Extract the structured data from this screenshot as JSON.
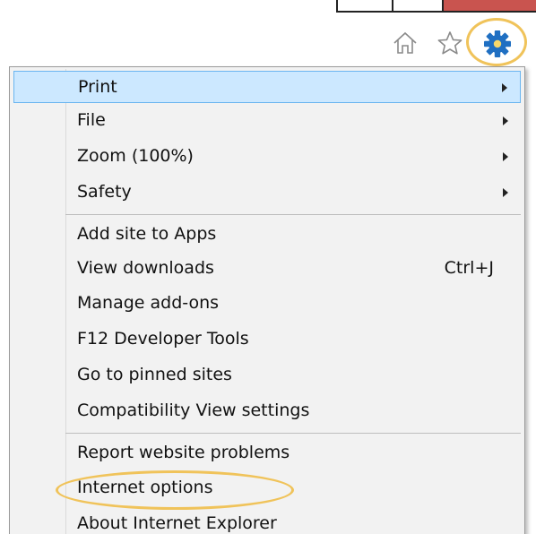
{
  "toolbar": {
    "icons": [
      "home-icon",
      "favorites-star-icon",
      "gear-icon"
    ]
  },
  "menu": {
    "groups": [
      [
        {
          "label": "Print",
          "has_submenu": true,
          "selected": true
        },
        {
          "label": "File",
          "has_submenu": true
        },
        {
          "label": "Zoom (100%)",
          "has_submenu": true
        },
        {
          "label": "Safety",
          "has_submenu": true
        }
      ],
      [
        {
          "label": "Add site to Apps"
        },
        {
          "label": "View downloads",
          "shortcut": "Ctrl+J"
        },
        {
          "label": "Manage add-ons"
        },
        {
          "label": "F12 Developer Tools"
        },
        {
          "label": "Go to pinned sites"
        },
        {
          "label": "Compatibility View settings"
        }
      ],
      [
        {
          "label": "Report website problems"
        },
        {
          "label": "Internet options",
          "highlighted": true
        },
        {
          "label": "About Internet Explorer"
        }
      ]
    ]
  },
  "colors": {
    "selection_fill": "#cce8ff",
    "selection_border": "#6ab5f0",
    "highlight_circle": "#f0c35a",
    "close_button": "#c9544f",
    "menu_background": "#f2f2f2"
  }
}
